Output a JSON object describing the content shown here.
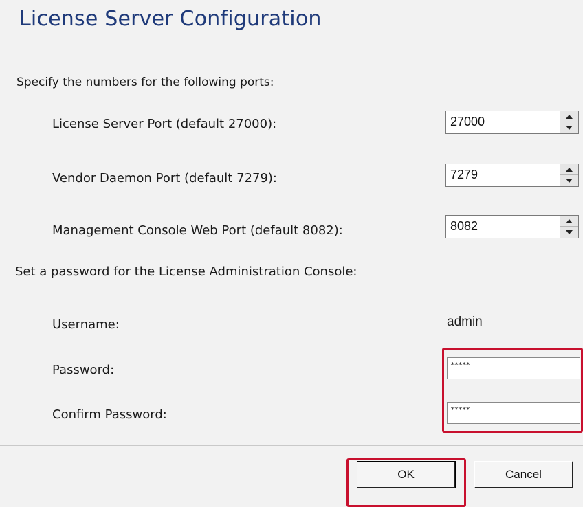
{
  "dialog": {
    "title": "License Server Configuration"
  },
  "ports": {
    "intro": "Specify the numbers for the following ports:",
    "fields": [
      {
        "label": "License Server Port (default 27000):",
        "value": "27000"
      },
      {
        "label": "Vendor Daemon Port (default 7279):",
        "value": "7279"
      },
      {
        "label": "Management Console Web Port (default 8082):",
        "value": "8082"
      }
    ]
  },
  "credentials": {
    "intro": "Set a password for the License Administration Console:",
    "username_label": "Username:",
    "username_value": "admin",
    "password_label": "Password:",
    "password_mask": "*****",
    "confirm_label": "Confirm Password:",
    "confirm_mask": "*****"
  },
  "buttons": {
    "ok_label": "OK",
    "cancel_label": "Cancel"
  },
  "colors": {
    "title": "#1f3a7a",
    "highlight": "#c8102e",
    "background": "#f2f2f2"
  },
  "icons": {
    "spinner_up": "triangle-up",
    "spinner_down": "triangle-down"
  }
}
